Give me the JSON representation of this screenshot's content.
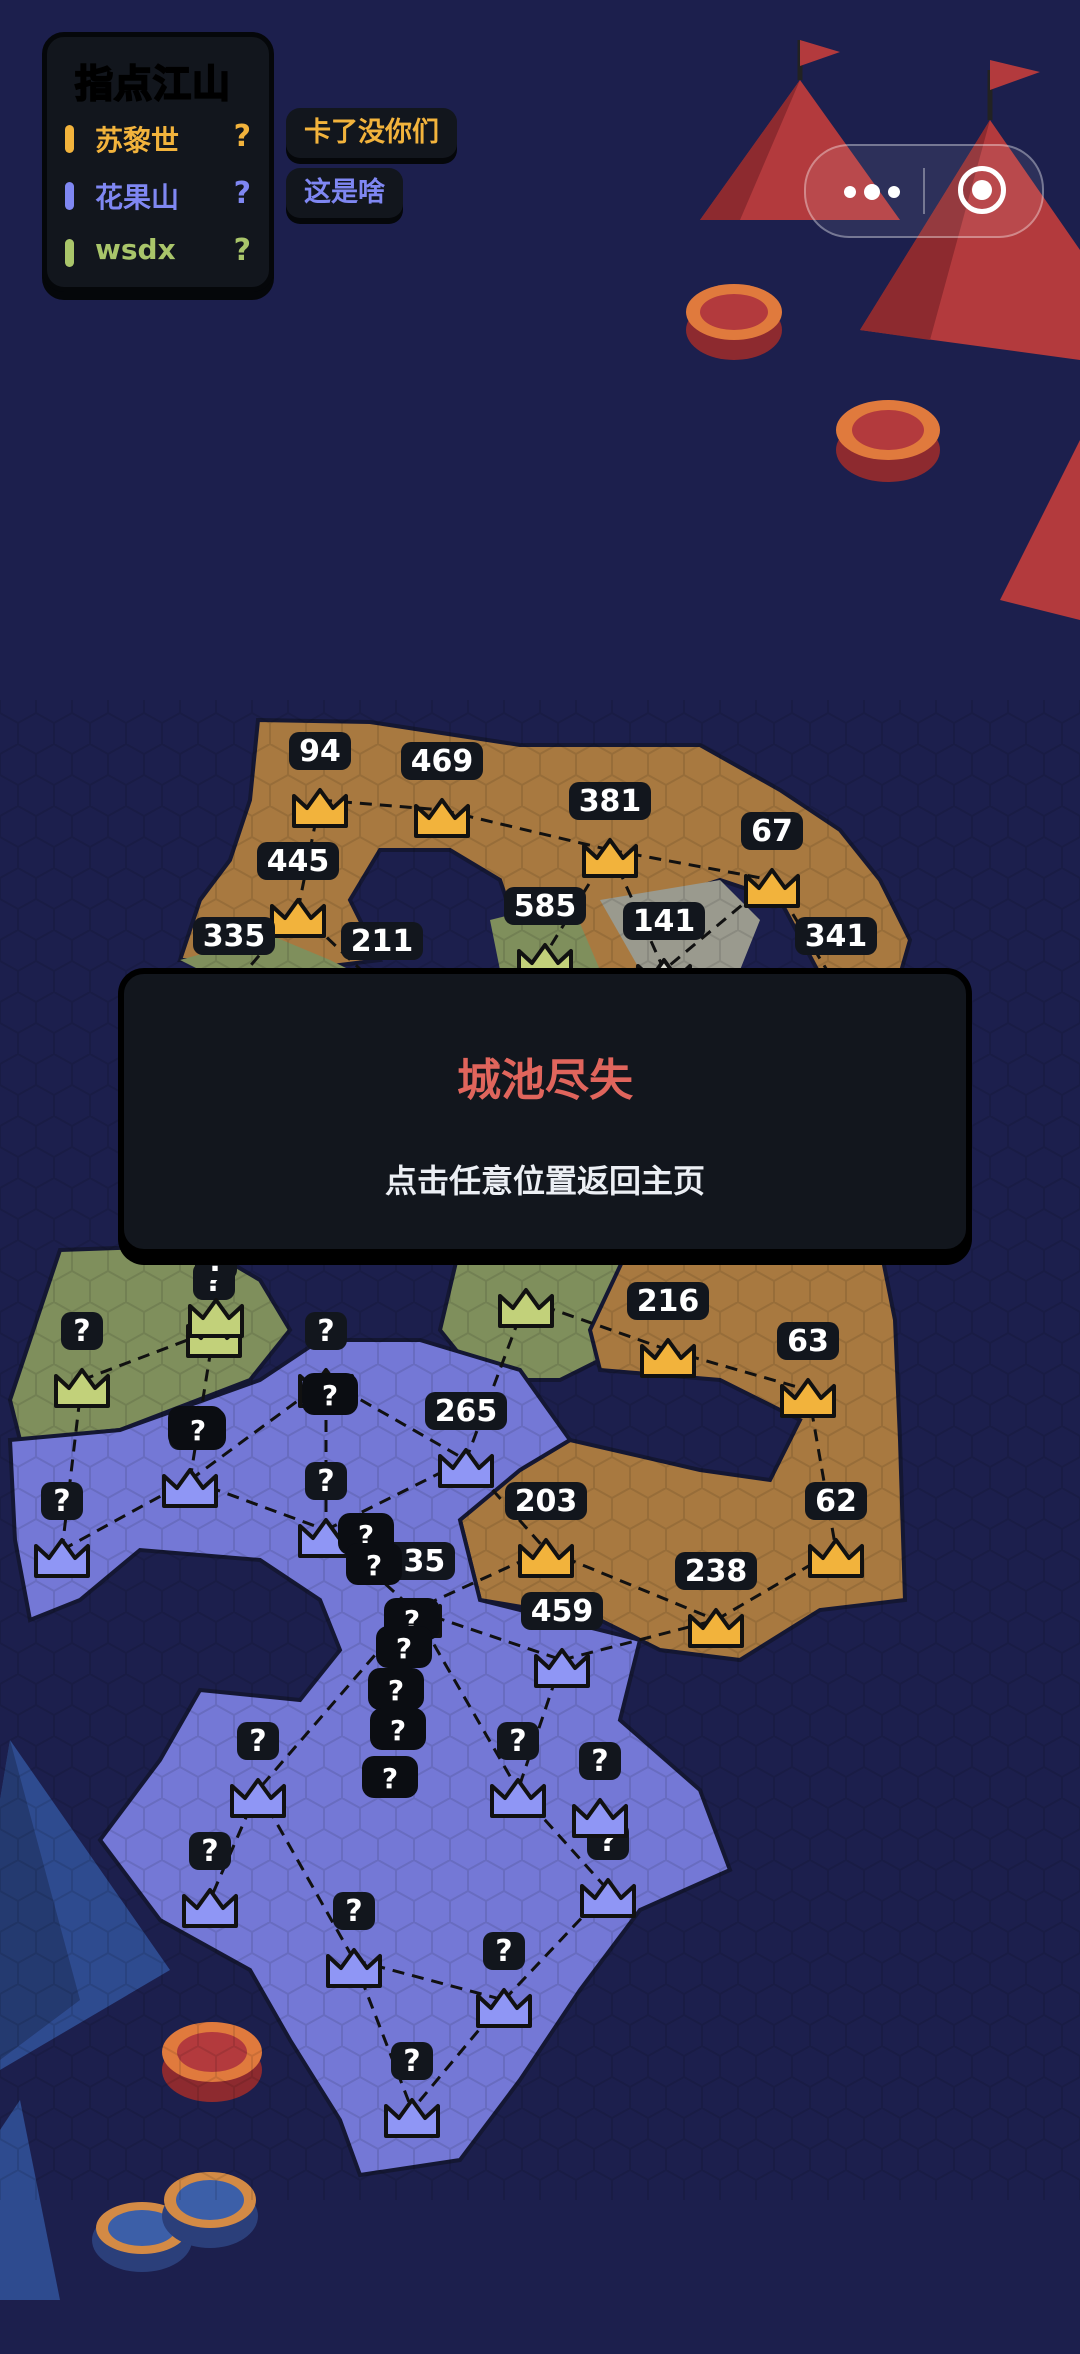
{
  "game": {
    "title": "指点江山",
    "players": [
      {
        "name": "苏黎世",
        "score": "?",
        "color": "#f2b33c"
      },
      {
        "name": "花果山",
        "score": "?",
        "color": "#7f87f2"
      },
      {
        "name": "wsdx",
        "score": "?",
        "color": "#a9c56a"
      }
    ],
    "chat_bubbles": [
      "卡了没你们",
      "这是啥"
    ]
  },
  "mini_program_capsule": {
    "more_icon": "more-dots-icon",
    "close_icon": "target-close-icon"
  },
  "modal": {
    "title": "城池尽失",
    "subtitle": "点击任意位置返回主页"
  },
  "colors": {
    "background": "#1c1f4d",
    "orange_territory": "#a87940",
    "blue_territory": "#7478d6",
    "green_territory": "#7f8f5c",
    "neutral_territory": "#9a9a8e",
    "modal_bg": "#12161d",
    "modal_title": "#e0655c"
  },
  "cities": [
    {
      "id": "o1",
      "label": "94",
      "owner": "orange"
    },
    {
      "id": "o2",
      "label": "469",
      "owner": "orange"
    },
    {
      "id": "o3",
      "label": "381",
      "owner": "orange"
    },
    {
      "id": "o4",
      "label": "67",
      "owner": "orange"
    },
    {
      "id": "o5",
      "label": "445",
      "owner": "orange"
    },
    {
      "id": "g1",
      "label": "335",
      "owner": "green"
    },
    {
      "id": "n1",
      "label": "211",
      "owner": "neutral"
    },
    {
      "id": "g2",
      "label": "585",
      "owner": "green"
    },
    {
      "id": "n2",
      "label": "141",
      "owner": "neutral"
    },
    {
      "id": "o6",
      "label": "341",
      "owner": "orange"
    },
    {
      "id": "g3",
      "label": "?",
      "owner": "green"
    },
    {
      "id": "g4",
      "label": "?",
      "owner": "green"
    },
    {
      "id": "g5",
      "label": "?",
      "owner": "green"
    },
    {
      "id": "g6",
      "label": "",
      "owner": "green"
    },
    {
      "id": "o7",
      "label": "216",
      "owner": "orange"
    },
    {
      "id": "o8",
      "label": "63",
      "owner": "orange"
    },
    {
      "id": "b1",
      "label": "?",
      "owner": "blue"
    },
    {
      "id": "b2",
      "label": "?",
      "owner": "blue"
    },
    {
      "id": "b3",
      "label": "?",
      "owner": "blue"
    },
    {
      "id": "b4",
      "label": "?",
      "owner": "blue"
    },
    {
      "id": "b5",
      "label": "265",
      "owner": "blue"
    },
    {
      "id": "o9",
      "label": "203",
      "owner": "orange"
    },
    {
      "id": "o10",
      "label": "62",
      "owner": "orange"
    },
    {
      "id": "b6",
      "label": "235",
      "owner": "blue"
    },
    {
      "id": "o11",
      "label": "238",
      "owner": "orange"
    },
    {
      "id": "b7",
      "label": "459",
      "owner": "blue"
    },
    {
      "id": "b8",
      "label": "?",
      "owner": "blue"
    },
    {
      "id": "b9",
      "label": "?",
      "owner": "blue"
    },
    {
      "id": "b10",
      "label": "?",
      "owner": "blue"
    },
    {
      "id": "b11",
      "label": "?",
      "owner": "blue"
    },
    {
      "id": "b12",
      "label": "?",
      "owner": "blue"
    },
    {
      "id": "b13",
      "label": "?",
      "owner": "blue"
    },
    {
      "id": "b14",
      "label": "?",
      "owner": "blue"
    },
    {
      "id": "b15",
      "label": "?",
      "owner": "blue"
    }
  ],
  "army_markers": [
    "?",
    "?",
    "?",
    "?",
    "?",
    "?",
    "?",
    "?",
    "?",
    "?"
  ]
}
